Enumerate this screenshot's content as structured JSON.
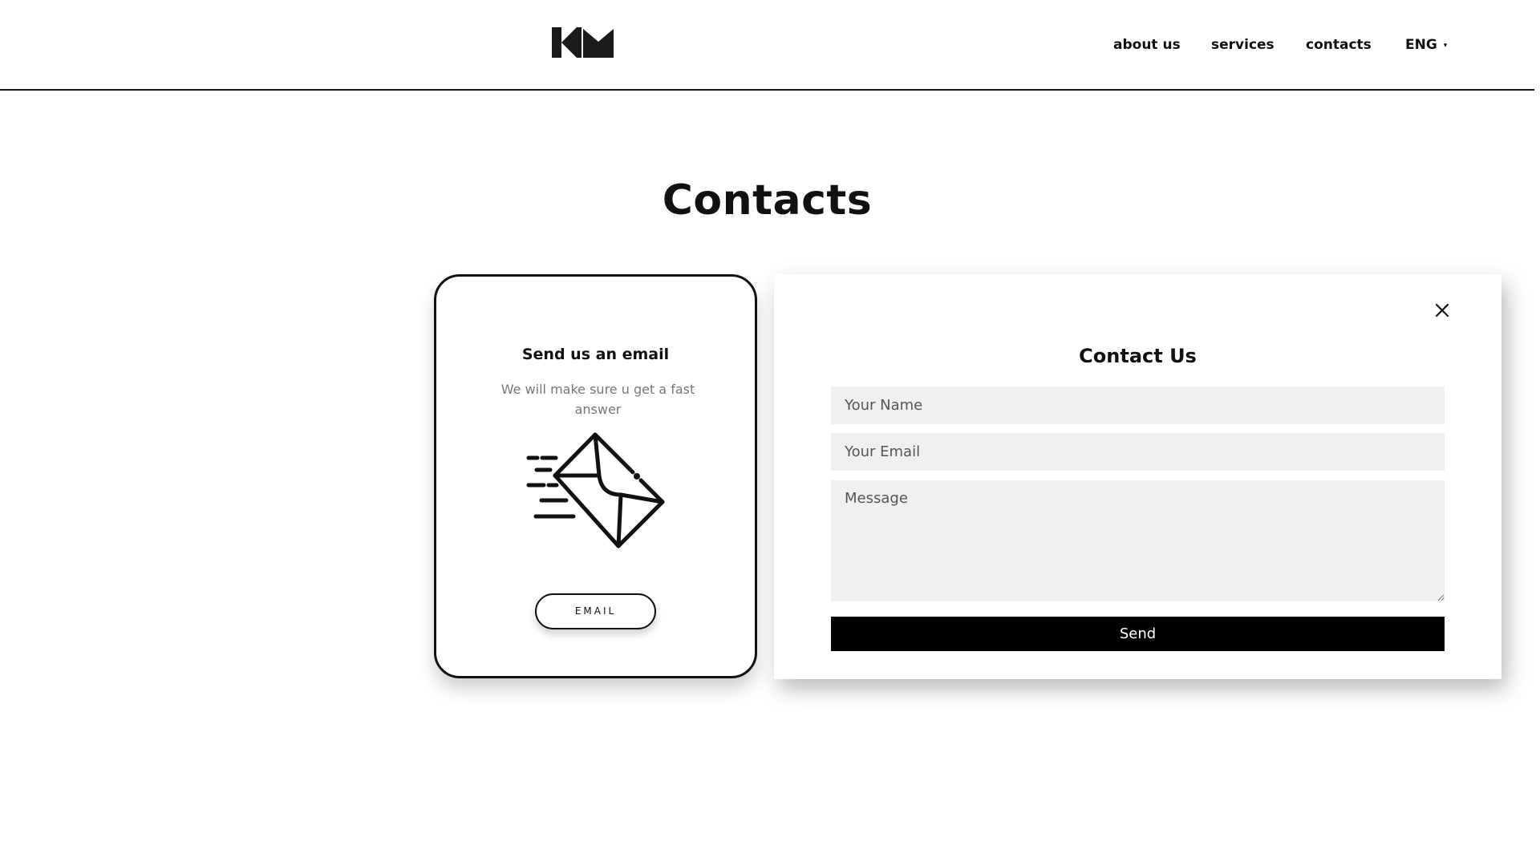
{
  "header": {
    "logo_icon": "km-logo-icon",
    "nav": [
      {
        "label": "about us"
      },
      {
        "label": "services"
      },
      {
        "label": "contacts"
      }
    ],
    "language": {
      "selected": "ENG",
      "caret": "▾"
    }
  },
  "page": {
    "title": "Contacts"
  },
  "email_card": {
    "title": "Send us an email",
    "subtitle": "We will make sure u get a fast answer",
    "icon": "flying-envelope-icon",
    "button_label": "EMAIL"
  },
  "contact_form": {
    "title": "Contact Us",
    "close_icon": "close-icon",
    "name_placeholder": "Your Name",
    "email_placeholder": "Your Email",
    "message_placeholder": "Message",
    "send_label": "Send"
  },
  "colors": {
    "text": "#111111",
    "muted": "#777777",
    "field_bg": "#f0f0f0",
    "button_bg": "#000000",
    "button_text": "#ffffff"
  }
}
